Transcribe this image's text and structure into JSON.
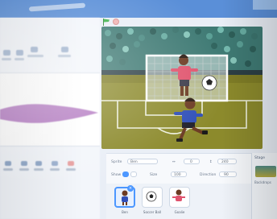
{
  "menubar": {
    "title_text": ""
  },
  "sprite_info": {
    "sprite_label": "Sprite",
    "sprite_value": "Ben",
    "x_value": "0",
    "y_value": "240",
    "show_label": "Show",
    "size_label": "Size",
    "size_value": "100",
    "direction_label": "Direction",
    "direction_value": "90"
  },
  "sprites": [
    {
      "name": "Ben"
    },
    {
      "name": "Soccer Ball"
    },
    {
      "name": "Goalie"
    }
  ],
  "selected_badge": "",
  "backdrop": {
    "title": "Stage",
    "count_label": "Backdrops"
  },
  "colors": {
    "accent": "#4c97ff",
    "menubar": "#5a8fd8",
    "green_flag": "#3db34a",
    "field_green": "#8c8a2c",
    "crowd_teal": "#3f7a74",
    "keeper_shirt": "#e0536d",
    "striker_shirt": "#2f4fb8"
  }
}
